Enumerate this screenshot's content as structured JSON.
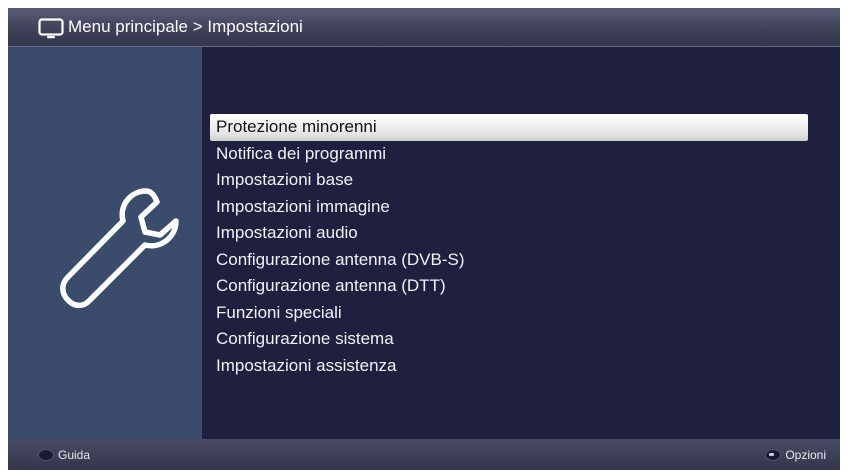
{
  "header": {
    "breadcrumb": "Menu principale > Impostazioni",
    "icon": "tv-icon"
  },
  "sidebar": {
    "icon": "wrench-icon"
  },
  "menu": {
    "selected_index": 0,
    "items": [
      "Protezione minorenni",
      "Notifica dei programmi",
      "Impostazioni base",
      "Impostazioni immagine",
      "Impostazioni audio",
      "Configurazione antenna (DVB-S)",
      "Configurazione antenna (DTT)",
      "Funzioni speciali",
      "Configurazione sistema",
      "Impostazioni assistenza"
    ]
  },
  "footer": {
    "left_label": "Guida",
    "right_label": "Opzioni"
  },
  "colors": {
    "background": "#1f2040",
    "sidebar": "#3a4b6b",
    "header": "#3e4058",
    "highlight": "#e6e6e6"
  }
}
